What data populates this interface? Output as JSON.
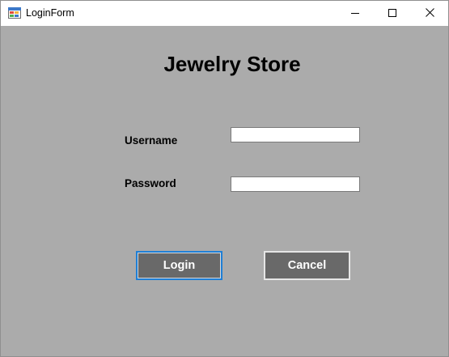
{
  "window": {
    "title": "LoginForm",
    "icons": {
      "app": "form-app-icon",
      "minimize": "minimize-icon",
      "maximize": "maximize-icon",
      "close": "close-icon"
    }
  },
  "form": {
    "heading": "Jewelry Store",
    "username_label": "Username",
    "username_value": "",
    "password_label": "Password",
    "password_value": "",
    "login_label": "Login",
    "cancel_label": "Cancel"
  },
  "colors": {
    "client_background": "#ababab",
    "button_background": "#696969",
    "focus_border": "#1f7fd6"
  }
}
